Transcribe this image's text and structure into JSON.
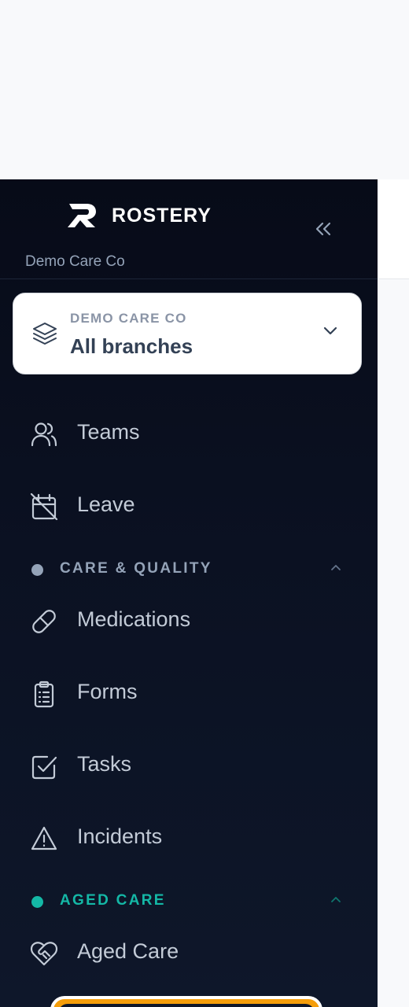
{
  "brand": {
    "name": "ROSTERY",
    "org": "Demo Care Co"
  },
  "branch_selector": {
    "org_label": "DEMO CARE CO",
    "branch": "All branches"
  },
  "nav": {
    "teams": "Teams",
    "leave": "Leave"
  },
  "sections": {
    "care_quality": {
      "title": "CARE & QUALITY",
      "dot_color": "#94a3b8",
      "items": {
        "medications": "Medications",
        "forms": "Forms",
        "tasks": "Tasks",
        "incidents": "Incidents"
      }
    },
    "aged_care": {
      "title": "AGED CARE",
      "dot_color": "#14b8a6",
      "items": {
        "aged_care": "Aged Care"
      }
    }
  },
  "colors": {
    "sidebar_bg": "#0b1122",
    "nav_text": "#c3cbd7",
    "accent_teal": "#14b8a6",
    "pill_orange": "#f59e0b"
  }
}
